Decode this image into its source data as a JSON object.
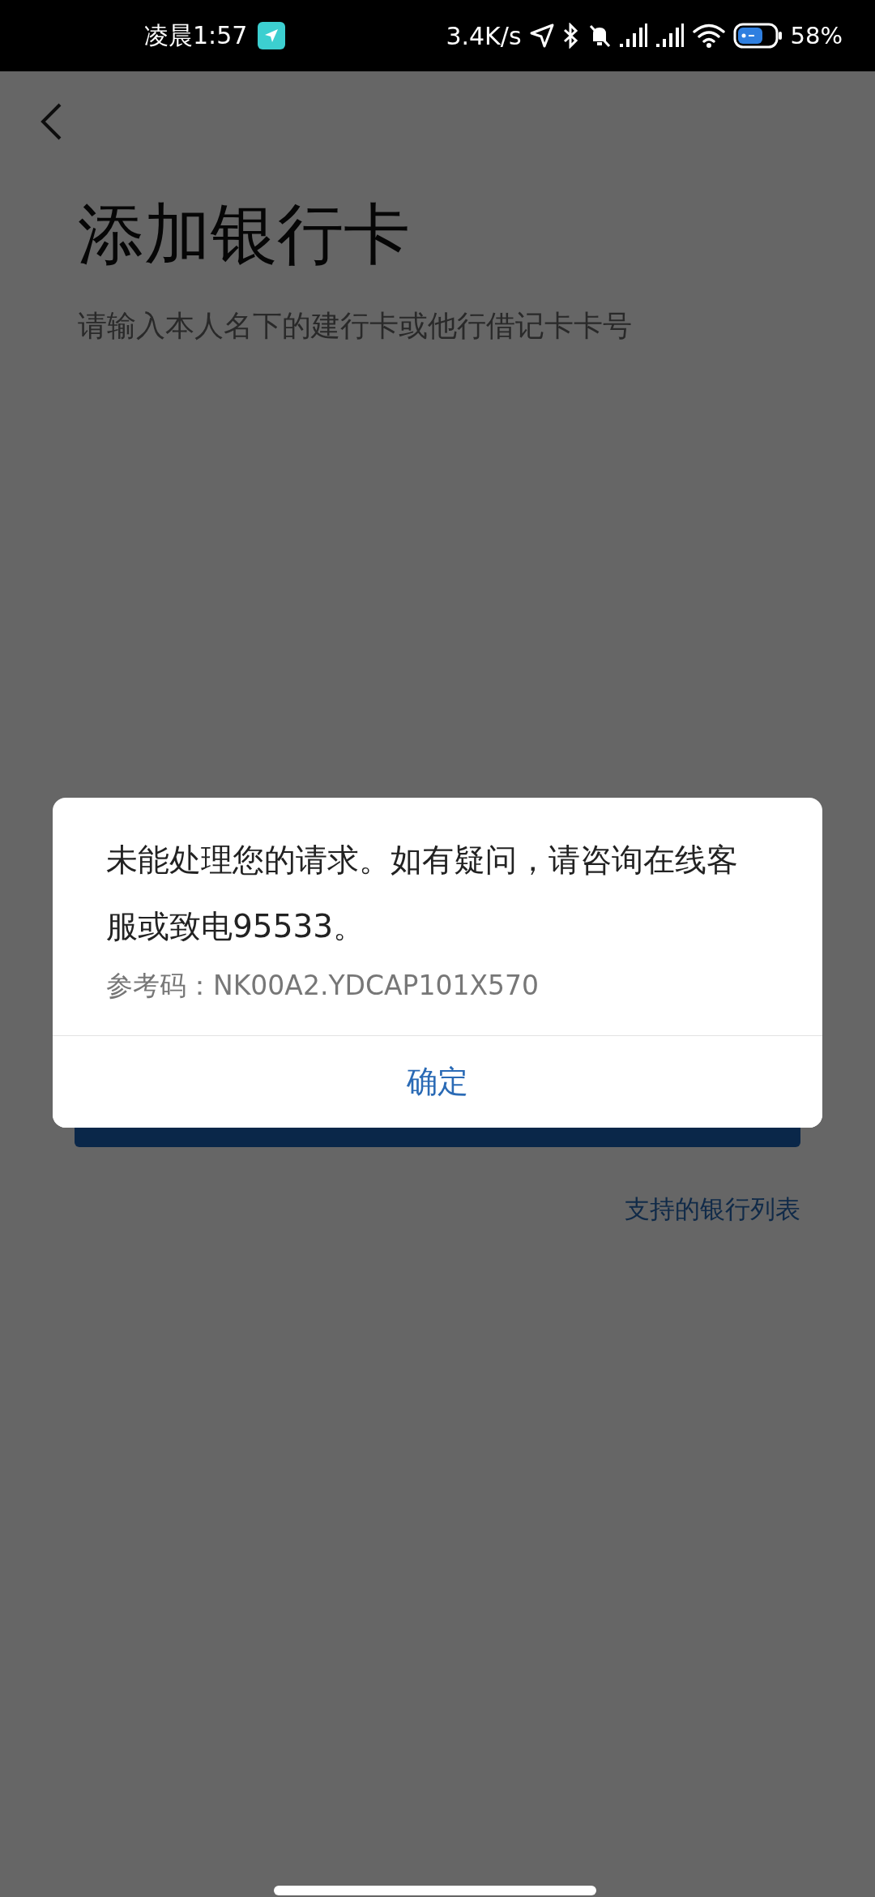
{
  "status_bar": {
    "time": "凌晨1:57",
    "net_speed": "3.4K/s",
    "battery": "58%"
  },
  "page": {
    "title": "添加银行卡",
    "subtitle": "请输入本人名下的建行卡或他行借记卡卡号",
    "link": "支持的银行列表"
  },
  "dialog": {
    "message": "未能处理您的请求。如有疑问，请咨询在线客服或致电95533。",
    "reference": "参考码：NK00A2.YDCAP101X570",
    "button": "确定"
  }
}
